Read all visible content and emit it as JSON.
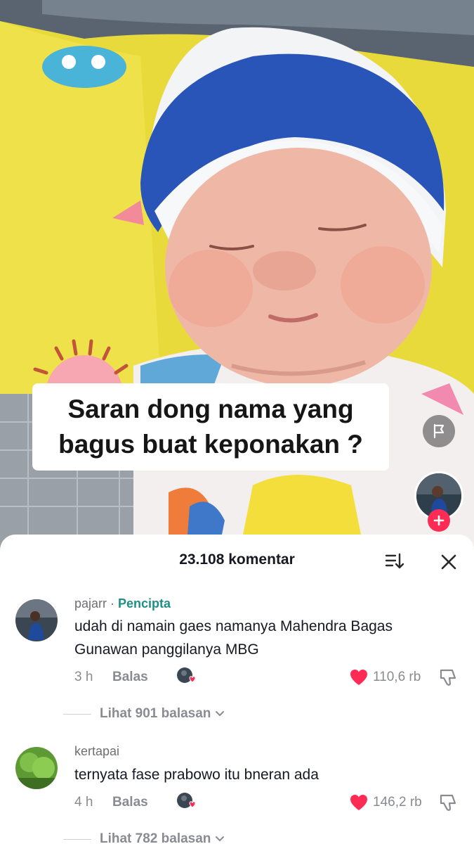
{
  "video": {
    "caption_line1": "Saran dong nama yang",
    "caption_line2": "bagus buat keponakan ?",
    "icons": {
      "report": "flag-icon",
      "follow": "plus-icon"
    }
  },
  "comments_panel": {
    "count_label": "23.108 komentar",
    "icons": {
      "sort": "sort-icon",
      "close": "close-icon"
    },
    "comments": [
      {
        "username": "pajarr",
        "separator": " · ",
        "badge": "Pencipta",
        "text": "udah di namain gaes namanya Mahendra Bagas Gunawan panggilanya MBG",
        "time": "3 h",
        "reply_label": "Balas",
        "likes": "110,6 rb",
        "view_replies": "Lihat 901 balasan"
      },
      {
        "username": "kertapai",
        "text": "ternyata fase prabowo itu bneran ada",
        "time": "4 h",
        "reply_label": "Balas",
        "likes": "146,2 rb",
        "view_replies": "Lihat 782 balasan"
      }
    ]
  },
  "colors": {
    "like_red": "#fe2c55",
    "creator_badge": "#1f8f86",
    "muted_text": "#8a8b91"
  }
}
